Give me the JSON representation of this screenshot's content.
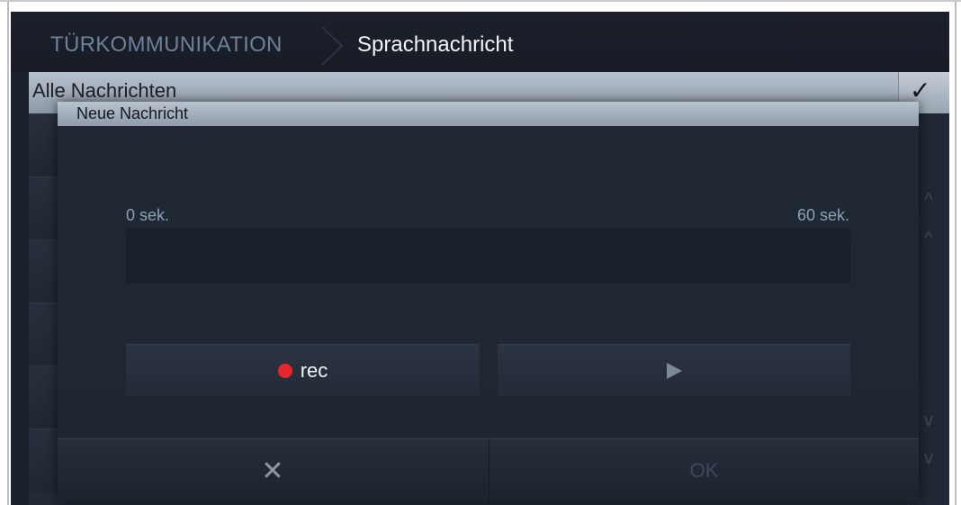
{
  "header": {
    "breadcrumb_root": "TÜRKOMMUNIKATION",
    "breadcrumb_current": "Sprachnachricht"
  },
  "list": {
    "header_label": "Alle Nachrichten",
    "confirm_icon": "checkmark-icon"
  },
  "dialog": {
    "title": "Neue Nachricht",
    "time_start": "0 sek.",
    "time_end": "60 sek.",
    "progress": 0,
    "rec_label": "rec",
    "play_icon": "play-icon",
    "cancel_icon": "close-icon",
    "ok_label": "OK"
  },
  "colors": {
    "rec_dot": "#e8262b",
    "screen_background": "#1c222d",
    "title_bar": "#aab4c2",
    "time_label": "#8aa0b8"
  }
}
